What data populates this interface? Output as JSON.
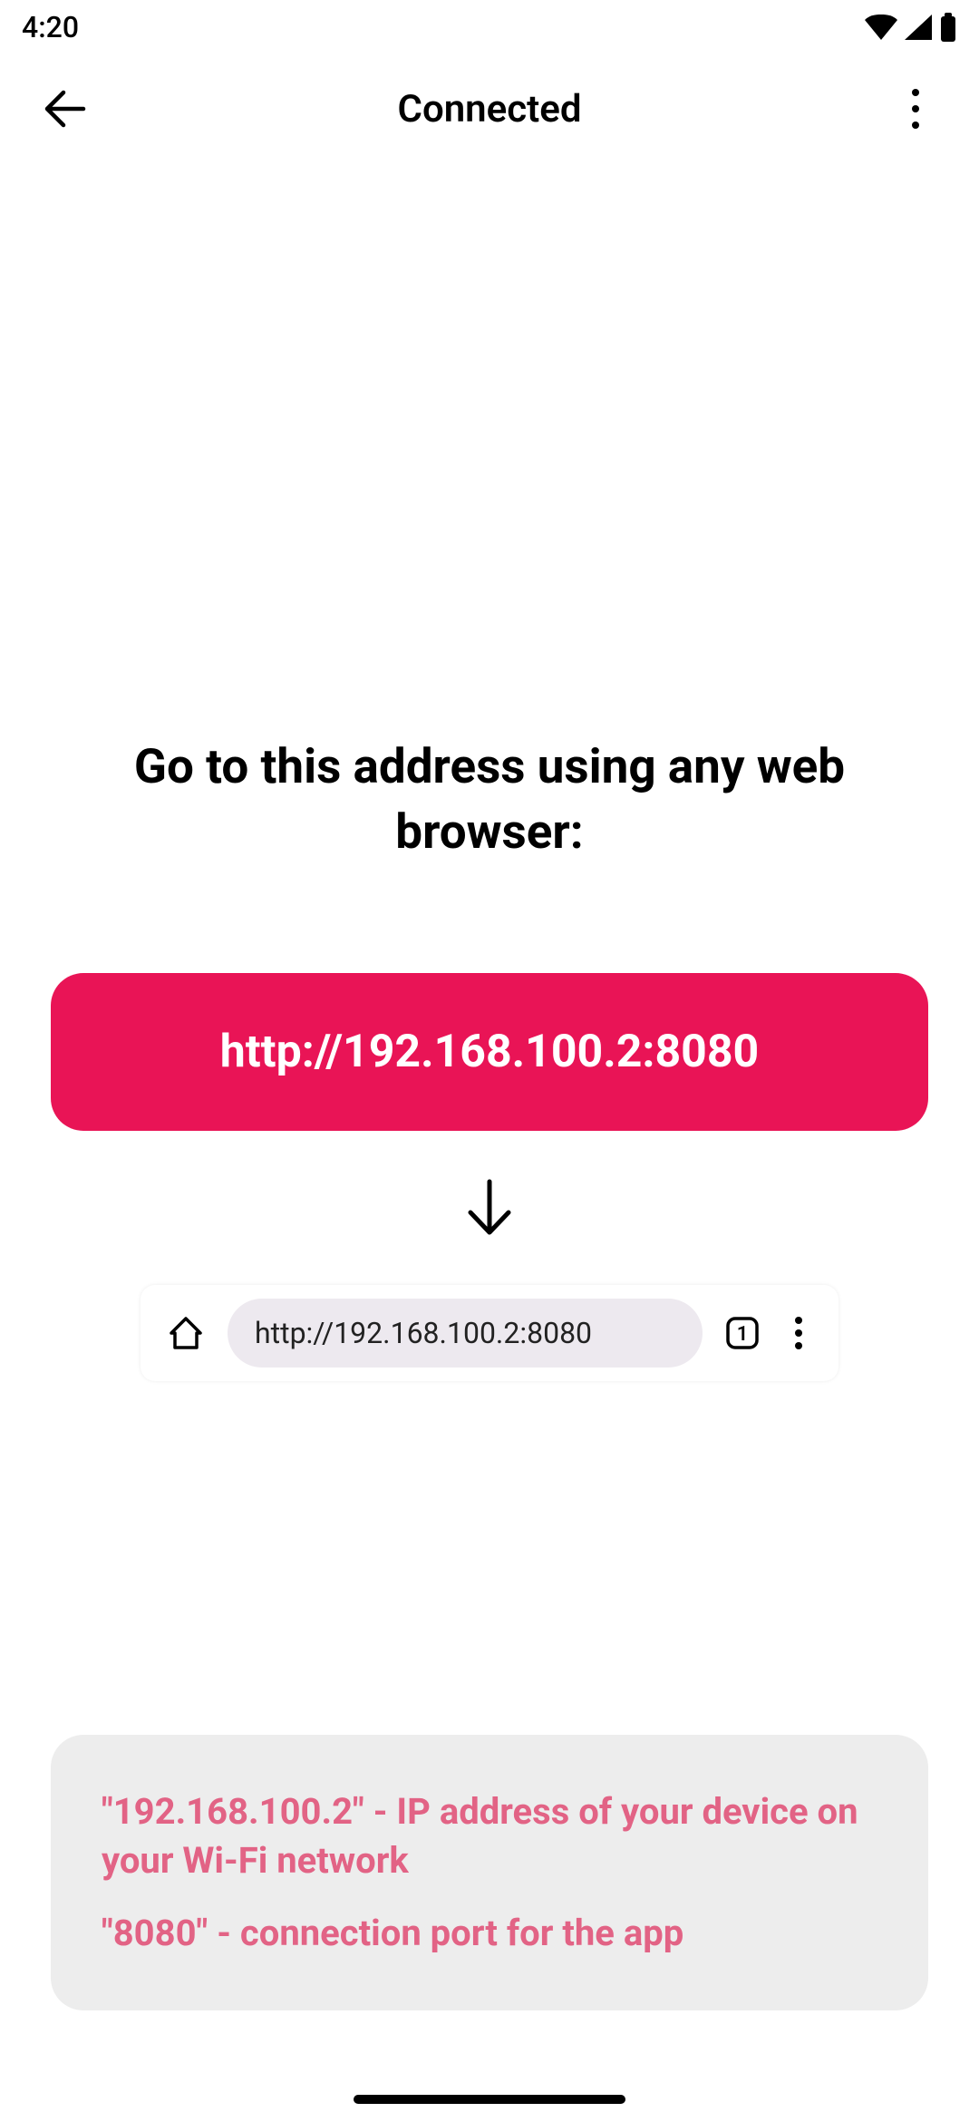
{
  "status_bar": {
    "time": "4:20"
  },
  "header": {
    "title": "Connected"
  },
  "main": {
    "instruction": "Go to this address using any web browser:",
    "url_button": "http://192.168.100.2:8080",
    "browser_url": "http://192.168.100.2:8080",
    "browser_tab_count": "1"
  },
  "info_box": {
    "line1": "\"192.168.100.2\" - IP address of your device on your Wi-Fi network",
    "line2": "\"8080\" - connection port for the app"
  }
}
